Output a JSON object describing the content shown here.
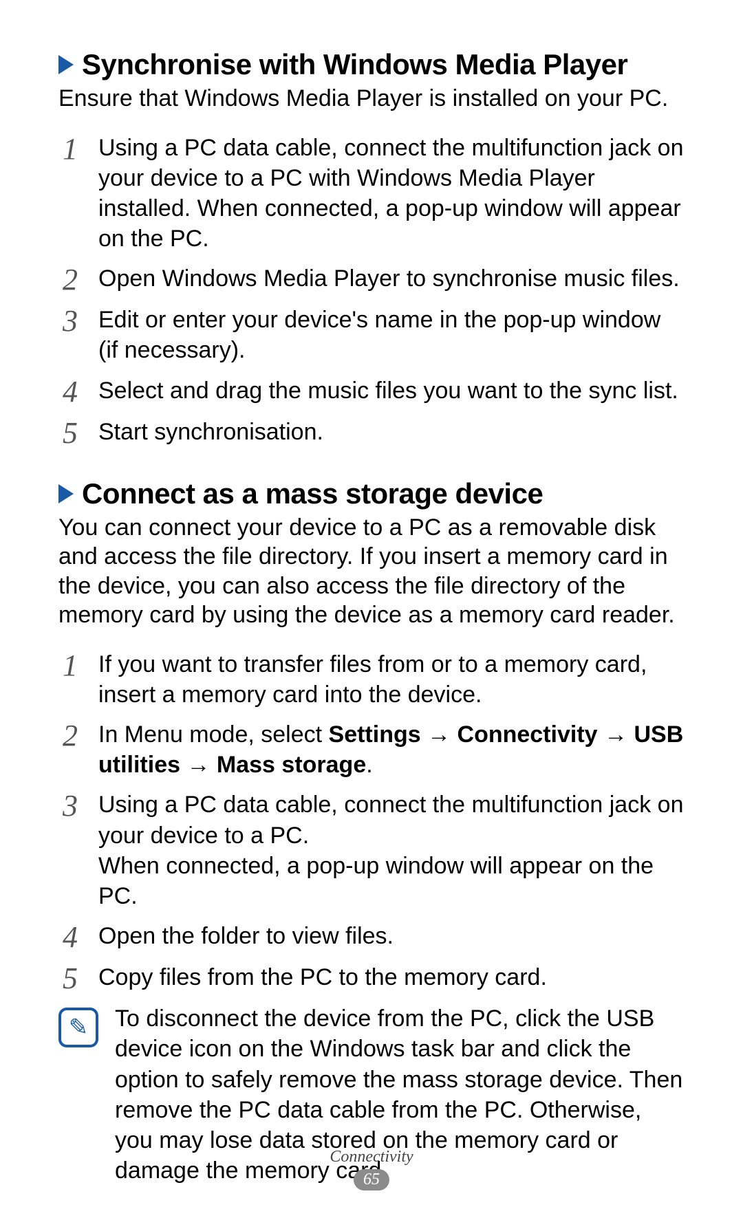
{
  "s1": {
    "heading": "Synchronise with Windows Media Player",
    "intro": "Ensure that Windows Media Player is installed on your PC.",
    "steps": [
      {
        "n": "1",
        "text": "Using a PC data cable, connect the multifunction jack on your device to a PC with Windows Media Player installed. When connected, a pop-up window will appear on the PC."
      },
      {
        "n": "2",
        "text": "Open Windows Media Player to synchronise music files."
      },
      {
        "n": "3",
        "text": "Edit or enter your device's name in the pop-up window (if necessary)."
      },
      {
        "n": "4",
        "text": "Select and drag the music files you want to the sync list."
      },
      {
        "n": "5",
        "text": "Start synchronisation."
      }
    ]
  },
  "s2": {
    "heading": "Connect as a mass storage device",
    "intro": "You can connect your device to a PC as a removable disk and access the file directory. If you insert a memory card in the device, you can also access the file directory of the memory card by using the device as a memory card reader.",
    "steps": [
      {
        "n": "1",
        "text": "If you want to transfer files from or to a memory card, insert a memory card into the device."
      },
      {
        "n": "2",
        "pre": "In Menu mode, select ",
        "bold": "Settings → Connectivity → USB utilities → Mass storage",
        "post": "."
      },
      {
        "n": "3",
        "text": "Using a PC data cable, connect the multifunction jack on your device to a PC.\nWhen connected, a pop-up window will appear on the PC."
      },
      {
        "n": "4",
        "text": "Open the folder to view files."
      },
      {
        "n": "5",
        "text": "Copy files from the PC to the memory card."
      }
    ],
    "note": "To disconnect the device from the PC, click the USB device icon on the Windows task bar and click the option to safely remove the mass storage device. Then remove the PC data cable from the PC. Otherwise, you may lose data stored on the memory card or damage the memory card."
  },
  "footer": {
    "section": "Connectivity",
    "page": "65"
  },
  "icons": {
    "note_glyph": "✎"
  }
}
